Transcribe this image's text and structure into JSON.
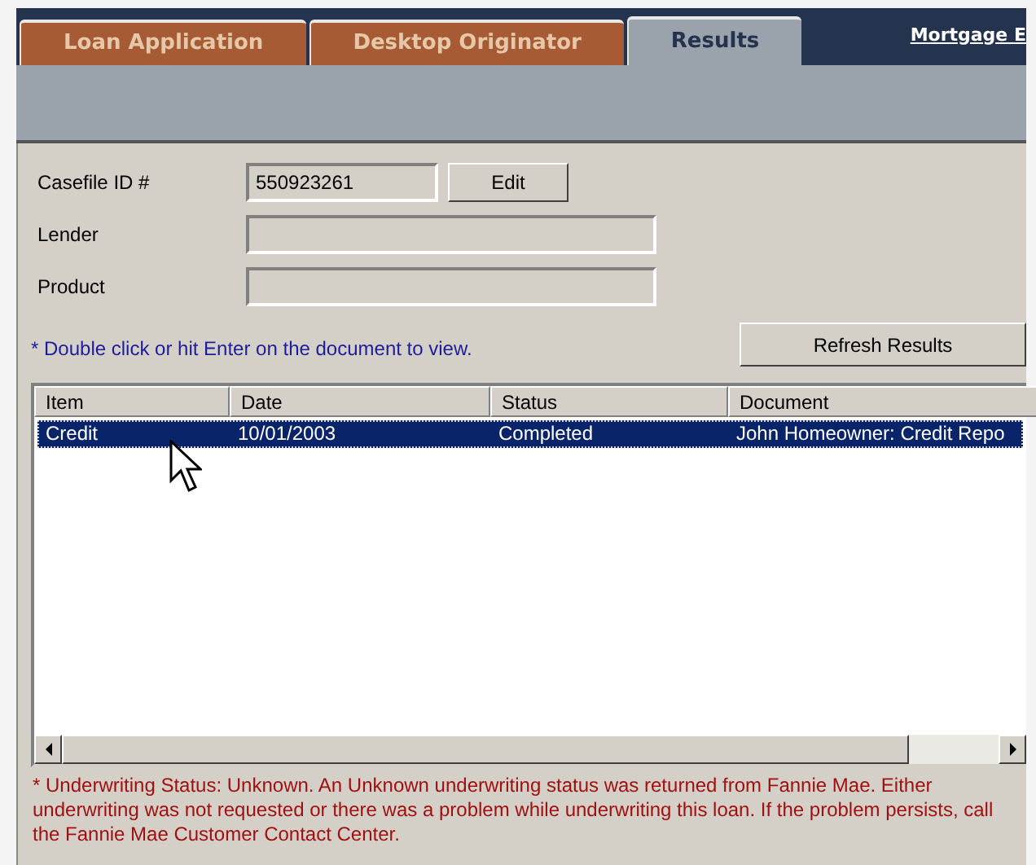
{
  "tabs": [
    {
      "label": "Loan Application",
      "selected": false
    },
    {
      "label": "Desktop Originator",
      "selected": false
    },
    {
      "label": "Results",
      "selected": true
    }
  ],
  "header_link": "Mortgage E",
  "form": {
    "fields": [
      {
        "label": "Casefile ID #",
        "value": "550923261"
      },
      {
        "label": "Lender"
      },
      {
        "label": "Product"
      }
    ],
    "edit_button": "Edit"
  },
  "hint": "* Double click or hit Enter on the document to view.",
  "refresh_button": "Refresh Results",
  "table": {
    "columns": [
      "Item",
      "Date",
      "Status",
      "Document"
    ],
    "rows": [
      {
        "cells": [
          "Credit",
          "10/01/2003",
          "Completed",
          "John Homeowner: Credit Repo"
        ],
        "selected": true
      }
    ]
  },
  "status_message": "* Underwriting Status: Unknown.  An Unknown underwriting status was returned from Fannie Mae. Either underwriting was not requested or there was a problem while underwriting this loan. If the problem persists, call the Fannie Mae Customer Contact Center."
}
